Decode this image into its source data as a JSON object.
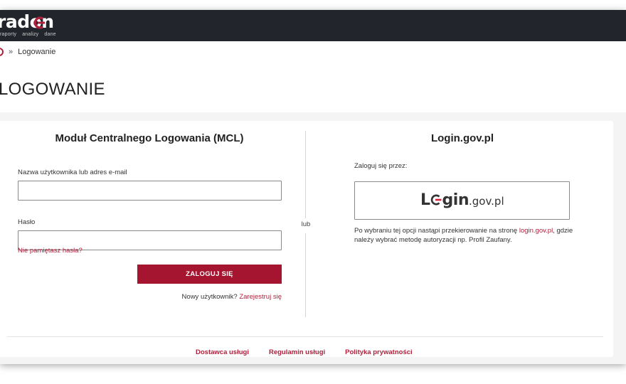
{
  "brand": {
    "name": "radon",
    "subtitle_items": [
      "raporty",
      "analizy",
      "dane"
    ],
    "accent_color": "#b0203a",
    "bar_color": "#22252c"
  },
  "breadcrumb": {
    "home_icon": "home-icon",
    "separator": "»",
    "current": "Logowanie"
  },
  "page": {
    "title": "LOGOWANIE"
  },
  "mcl": {
    "title": "Moduł Centralnego Logowania (MCL)",
    "username_label": "Nazwa użytkownika lub adres e-mail",
    "username_value": "",
    "password_label": "Hasło",
    "password_value": "",
    "forgot_link": "Nie pamiętasz hasła?",
    "login_button": "ZALOGUJ SIĘ",
    "new_user_text": "Nowy użytkownik?",
    "register_link": "Zarejestruj się"
  },
  "divider_label": "lub",
  "gov": {
    "title": "Login.gov.pl",
    "label": "Zaloguj się przez:",
    "button_logo_prefix": "L",
    "button_logo_main": "gin",
    "button_logo_suffix": ".gov.pl",
    "note_before": "Po wybraniu tej opcji nastąpi przekierowanie na stronę ",
    "note_link": "login.gov.pl",
    "note_after": ", gdzie należy wybrać metodę autoryzacji np. Profil Zaufany."
  },
  "footer": {
    "links": [
      "Dostawca usługi",
      "Regulamin usługi",
      "Polityka prywatności"
    ]
  }
}
